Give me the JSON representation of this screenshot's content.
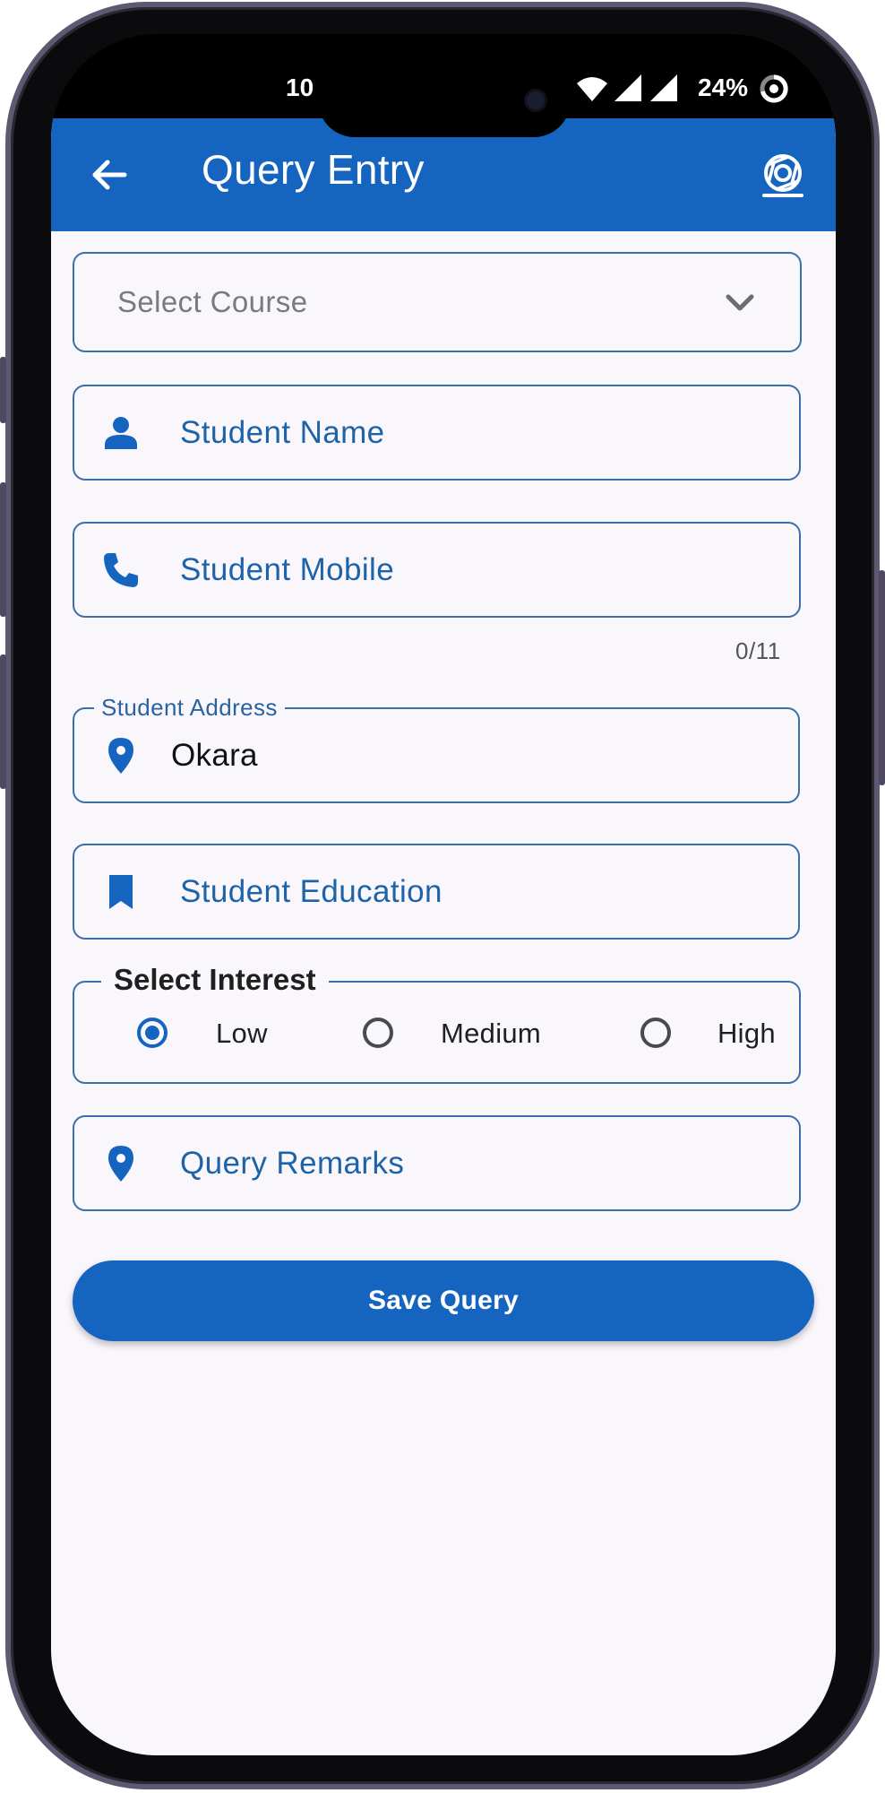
{
  "status_bar": {
    "time": "10",
    "battery_percent": "24%",
    "icons": [
      "wifi-icon",
      "signal-icon",
      "signal-icon",
      "battery-ring-icon"
    ]
  },
  "app_bar": {
    "title": "Query Entry",
    "back_icon": "arrow-left-icon",
    "action_icon": "camera-lens-icon",
    "color": "#1565c0"
  },
  "form": {
    "course_select": {
      "placeholder": "Select Course",
      "icon": "chevron-down-icon"
    },
    "student_name": {
      "label": "Student Name",
      "icon": "person-icon"
    },
    "student_mobile": {
      "label": "Student Mobile",
      "icon": "phone-icon",
      "counter": "0/11"
    },
    "student_address": {
      "label": "Student Address",
      "value": "Okara",
      "icon": "location-pin-icon"
    },
    "student_education": {
      "label": "Student Education",
      "icon": "bookmark-icon"
    },
    "interest": {
      "legend": "Select Interest",
      "options": [
        {
          "label": "Low",
          "selected": true
        },
        {
          "label": "Medium",
          "selected": false
        },
        {
          "label": "High",
          "selected": false
        }
      ]
    },
    "query_remarks": {
      "label": "Query Remarks",
      "icon": "location-pin-icon"
    },
    "save_button": {
      "label": "Save Query"
    }
  }
}
